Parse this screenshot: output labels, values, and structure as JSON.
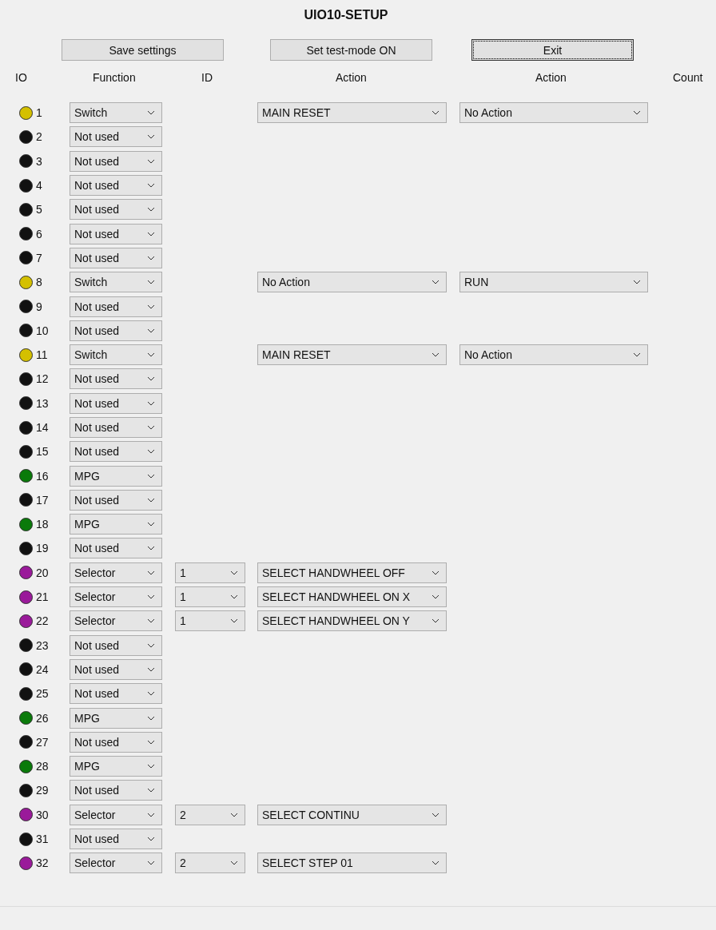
{
  "title": "UIO10-SETUP",
  "buttons": [
    {
      "label": "Save settings",
      "focused": false
    },
    {
      "label": "Set test-mode ON",
      "focused": false
    },
    {
      "label": "Exit",
      "focused": true
    }
  ],
  "columns": [
    "IO",
    "Function",
    "ID",
    "Action",
    "Action",
    "Count"
  ],
  "rows": [
    {
      "io": "1",
      "color": "#d4c000",
      "function": "Switch",
      "action_1": "MAIN RESET",
      "action_2": "No Action"
    },
    {
      "io": "2",
      "color": "#111111",
      "function": "Not used"
    },
    {
      "io": "3",
      "color": "#111111",
      "function": "Not used"
    },
    {
      "io": "4",
      "color": "#111111",
      "function": "Not used"
    },
    {
      "io": "5",
      "color": "#111111",
      "function": "Not used"
    },
    {
      "io": "6",
      "color": "#111111",
      "function": "Not used"
    },
    {
      "io": "7",
      "color": "#111111",
      "function": "Not used"
    },
    {
      "io": "8",
      "color": "#d4c000",
      "function": "Switch",
      "action_1": "No Action",
      "action_2": "RUN"
    },
    {
      "io": "9",
      "color": "#111111",
      "function": "Not used"
    },
    {
      "io": "10",
      "color": "#111111",
      "function": "Not used"
    },
    {
      "io": "11",
      "color": "#d4c000",
      "function": "Switch",
      "action_1": "MAIN RESET",
      "action_2": "No Action"
    },
    {
      "io": "12",
      "color": "#111111",
      "function": "Not used"
    },
    {
      "io": "13",
      "color": "#111111",
      "function": "Not used"
    },
    {
      "io": "14",
      "color": "#111111",
      "function": "Not used"
    },
    {
      "io": "15",
      "color": "#111111",
      "function": "Not used"
    },
    {
      "io": "16",
      "color": "#0a7a0a",
      "function": "MPG"
    },
    {
      "io": "17",
      "color": "#111111",
      "function": "Not used"
    },
    {
      "io": "18",
      "color": "#0a7a0a",
      "function": "MPG"
    },
    {
      "io": "19",
      "color": "#111111",
      "function": "Not used"
    },
    {
      "io": "20",
      "color": "#9a1a9a",
      "function": "Selector",
      "id": "1",
      "action_1": "SELECT HANDWHEEL OFF"
    },
    {
      "io": "21",
      "color": "#9a1a9a",
      "function": "Selector",
      "id": "1",
      "action_1": "SELECT HANDWHEEL ON X"
    },
    {
      "io": "22",
      "color": "#9a1a9a",
      "function": "Selector",
      "id": "1",
      "action_1": "SELECT HANDWHEEL ON Y"
    },
    {
      "io": "23",
      "color": "#111111",
      "function": "Not used"
    },
    {
      "io": "24",
      "color": "#111111",
      "function": "Not used"
    },
    {
      "io": "25",
      "color": "#111111",
      "function": "Not used"
    },
    {
      "io": "26",
      "color": "#0a7a0a",
      "function": "MPG"
    },
    {
      "io": "27",
      "color": "#111111",
      "function": "Not used"
    },
    {
      "io": "28",
      "color": "#0a7a0a",
      "function": "MPG"
    },
    {
      "io": "29",
      "color": "#111111",
      "function": "Not used"
    },
    {
      "io": "30",
      "color": "#9a1a9a",
      "function": "Selector",
      "id": "2",
      "action_1": "SELECT CONTINU"
    },
    {
      "io": "31",
      "color": "#111111",
      "function": "Not used"
    },
    {
      "io": "32",
      "color": "#9a1a9a",
      "function": "Selector",
      "id": "2",
      "action_1": "SELECT STEP 01"
    }
  ]
}
